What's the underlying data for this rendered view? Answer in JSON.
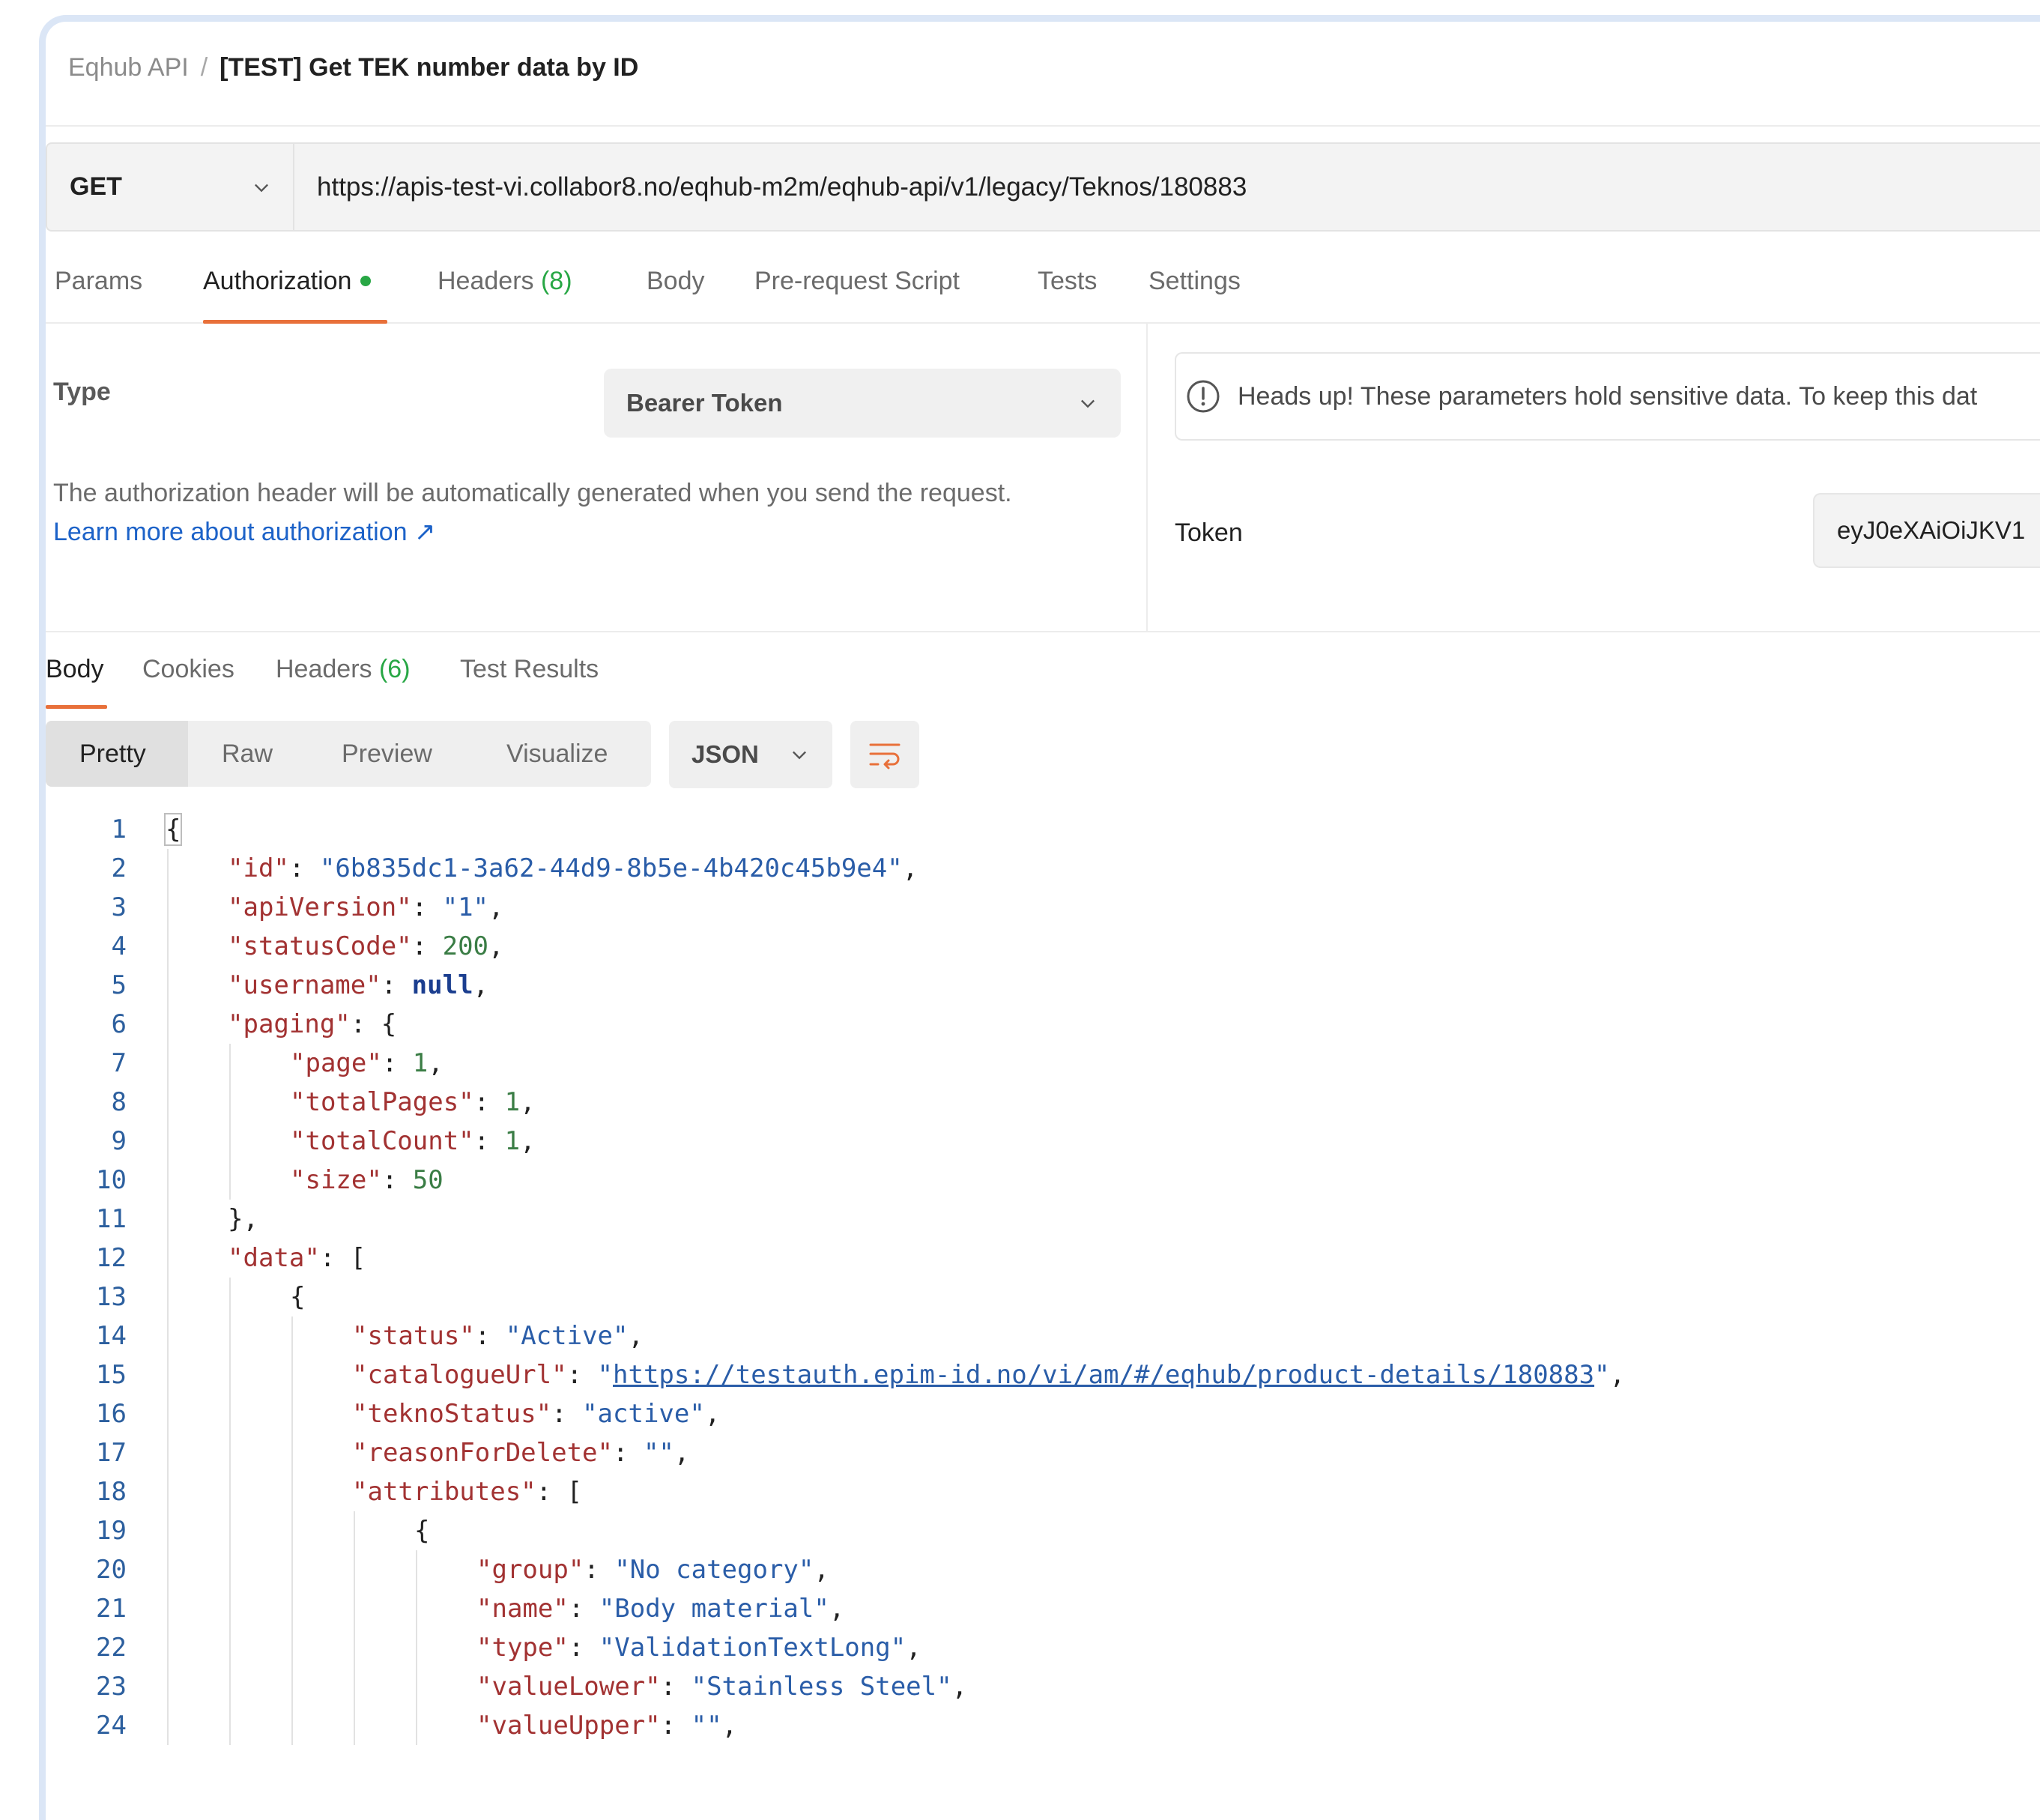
{
  "breadcrumb": {
    "parent": "Eqhub API",
    "separator": "/",
    "current": "[TEST] Get TEK number data by ID"
  },
  "request": {
    "method": "GET",
    "url": "https://apis-test-vi.collabor8.no/eqhub-m2m/eqhub-api/v1/legacy/Teknos/180883"
  },
  "request_tabs": {
    "params": "Params",
    "authorization": "Authorization",
    "headers": "Headers",
    "headers_count": "(8)",
    "body": "Body",
    "prerequest": "Pre-request Script",
    "tests": "Tests",
    "settings": "Settings"
  },
  "auth": {
    "type_label": "Type",
    "type_value": "Bearer Token",
    "description": "The authorization header will be automatically generated when you send the request.",
    "learn_more": "Learn more about authorization ↗",
    "headsup": "Heads up! These parameters hold sensitive data. To keep this dat",
    "token_label": "Token",
    "token_value": "eyJ0eXAiOiJKV1"
  },
  "response_tabs": {
    "body": "Body",
    "cookies": "Cookies",
    "headers": "Headers",
    "headers_count": "(6)",
    "test_results": "Test Results"
  },
  "view": {
    "modes": [
      "Pretty",
      "Raw",
      "Preview",
      "Visualize"
    ],
    "active": "Pretty",
    "format": "JSON"
  },
  "colors": {
    "accent": "#e8703a",
    "key": "#a23232",
    "string": "#2a5da8",
    "number": "#3a7d45",
    "keyword": "#1b3e8f",
    "success": "#28a745",
    "link": "#1c62c8"
  },
  "icons": {
    "method_dropdown": "chevron-down-icon",
    "type_dropdown": "chevron-down-icon",
    "format_dropdown": "chevron-down-icon",
    "wrap": "wrap-lines-icon",
    "info": "info-circle-icon"
  },
  "code_lines": [
    {
      "n": "1",
      "indent": 0,
      "tokens": [
        [
          "p",
          "{"
        ]
      ]
    },
    {
      "n": "2",
      "indent": 1,
      "tokens": [
        [
          "k",
          "\"id\""
        ],
        [
          "p",
          ": "
        ],
        [
          "s",
          "\"6b835dc1-3a62-44d9-8b5e-4b420c45b9e4\""
        ],
        [
          "p",
          ","
        ]
      ]
    },
    {
      "n": "3",
      "indent": 1,
      "tokens": [
        [
          "k",
          "\"apiVersion\""
        ],
        [
          "p",
          ": "
        ],
        [
          "s",
          "\"1\""
        ],
        [
          "p",
          ","
        ]
      ]
    },
    {
      "n": "4",
      "indent": 1,
      "tokens": [
        [
          "k",
          "\"statusCode\""
        ],
        [
          "p",
          ": "
        ],
        [
          "n",
          "200"
        ],
        [
          "p",
          ","
        ]
      ]
    },
    {
      "n": "5",
      "indent": 1,
      "tokens": [
        [
          "k",
          "\"username\""
        ],
        [
          "p",
          ": "
        ],
        [
          "kw",
          "null"
        ],
        [
          "p",
          ","
        ]
      ]
    },
    {
      "n": "6",
      "indent": 1,
      "tokens": [
        [
          "k",
          "\"paging\""
        ],
        [
          "p",
          ": {"
        ]
      ]
    },
    {
      "n": "7",
      "indent": 2,
      "tokens": [
        [
          "k",
          "\"page\""
        ],
        [
          "p",
          ": "
        ],
        [
          "n",
          "1"
        ],
        [
          "p",
          ","
        ]
      ]
    },
    {
      "n": "8",
      "indent": 2,
      "tokens": [
        [
          "k",
          "\"totalPages\""
        ],
        [
          "p",
          ": "
        ],
        [
          "n",
          "1"
        ],
        [
          "p",
          ","
        ]
      ]
    },
    {
      "n": "9",
      "indent": 2,
      "tokens": [
        [
          "k",
          "\"totalCount\""
        ],
        [
          "p",
          ": "
        ],
        [
          "n",
          "1"
        ],
        [
          "p",
          ","
        ]
      ]
    },
    {
      "n": "10",
      "indent": 2,
      "tokens": [
        [
          "k",
          "\"size\""
        ],
        [
          "p",
          ": "
        ],
        [
          "n",
          "50"
        ]
      ]
    },
    {
      "n": "11",
      "indent": 1,
      "tokens": [
        [
          "p",
          "},"
        ]
      ]
    },
    {
      "n": "12",
      "indent": 1,
      "tokens": [
        [
          "k",
          "\"data\""
        ],
        [
          "p",
          ": ["
        ]
      ]
    },
    {
      "n": "13",
      "indent": 2,
      "tokens": [
        [
          "p",
          "{"
        ]
      ]
    },
    {
      "n": "14",
      "indent": 3,
      "tokens": [
        [
          "k",
          "\"status\""
        ],
        [
          "p",
          ": "
        ],
        [
          "s",
          "\"Active\""
        ],
        [
          "p",
          ","
        ]
      ]
    },
    {
      "n": "15",
      "indent": 3,
      "tokens": [
        [
          "k",
          "\"catalogueUrl\""
        ],
        [
          "p",
          ": "
        ],
        [
          "s",
          "\""
        ],
        [
          "u",
          "https://testauth.epim-id.no/vi/am/#/eqhub/product-details/180883"
        ],
        [
          "s",
          "\""
        ],
        [
          "p",
          ","
        ]
      ]
    },
    {
      "n": "16",
      "indent": 3,
      "tokens": [
        [
          "k",
          "\"teknoStatus\""
        ],
        [
          "p",
          ": "
        ],
        [
          "s",
          "\"active\""
        ],
        [
          "p",
          ","
        ]
      ]
    },
    {
      "n": "17",
      "indent": 3,
      "tokens": [
        [
          "k",
          "\"reasonForDelete\""
        ],
        [
          "p",
          ": "
        ],
        [
          "s",
          "\"\""
        ],
        [
          "p",
          ","
        ]
      ]
    },
    {
      "n": "18",
      "indent": 3,
      "tokens": [
        [
          "k",
          "\"attributes\""
        ],
        [
          "p",
          ": ["
        ]
      ]
    },
    {
      "n": "19",
      "indent": 4,
      "tokens": [
        [
          "p",
          "{"
        ]
      ]
    },
    {
      "n": "20",
      "indent": 5,
      "tokens": [
        [
          "k",
          "\"group\""
        ],
        [
          "p",
          ": "
        ],
        [
          "s",
          "\"No category\""
        ],
        [
          "p",
          ","
        ]
      ]
    },
    {
      "n": "21",
      "indent": 5,
      "tokens": [
        [
          "k",
          "\"name\""
        ],
        [
          "p",
          ": "
        ],
        [
          "s",
          "\"Body material\""
        ],
        [
          "p",
          ","
        ]
      ]
    },
    {
      "n": "22",
      "indent": 5,
      "tokens": [
        [
          "k",
          "\"type\""
        ],
        [
          "p",
          ": "
        ],
        [
          "s",
          "\"ValidationTextLong\""
        ],
        [
          "p",
          ","
        ]
      ]
    },
    {
      "n": "23",
      "indent": 5,
      "tokens": [
        [
          "k",
          "\"valueLower\""
        ],
        [
          "p",
          ": "
        ],
        [
          "s",
          "\"Stainless Steel\""
        ],
        [
          "p",
          ","
        ]
      ]
    },
    {
      "n": "24",
      "indent": 5,
      "tokens": [
        [
          "k",
          "\"valueUpper\""
        ],
        [
          "p",
          ": "
        ],
        [
          "s",
          "\"\""
        ],
        [
          "p",
          ","
        ]
      ]
    }
  ]
}
